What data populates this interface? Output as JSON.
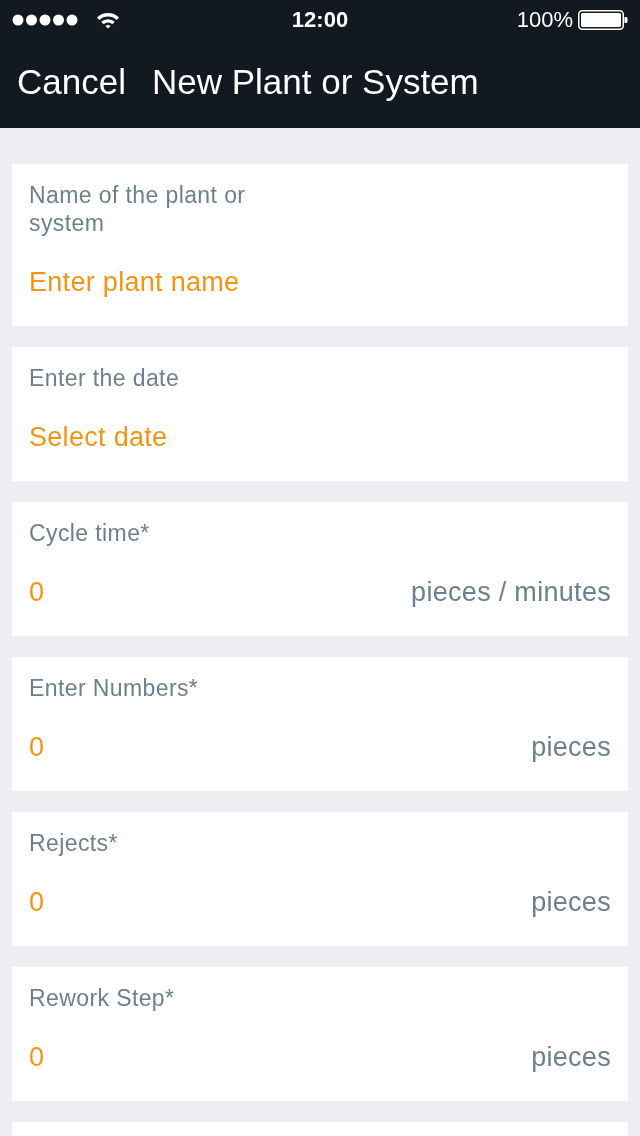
{
  "status_bar": {
    "time": "12:00",
    "battery": "100%"
  },
  "nav_bar": {
    "cancel": "Cancel",
    "title": "New Plant or System"
  },
  "fields": [
    {
      "kind": "text",
      "label": "Name of the plant or system",
      "placeholder": "Enter plant name"
    },
    {
      "kind": "date",
      "label": "Enter the date",
      "placeholder": "Select date"
    },
    {
      "kind": "number",
      "label": "Cycle time*",
      "value": "0",
      "unit": "pieces / minutes"
    },
    {
      "kind": "number",
      "label": "Enter Numbers*",
      "value": "0",
      "unit": "pieces"
    },
    {
      "kind": "number",
      "label": "Rejects*",
      "value": "0",
      "unit": "pieces"
    },
    {
      "kind": "number",
      "label": "Rework Step*",
      "value": "0",
      "unit": "pieces"
    },
    {
      "kind": "cut_off"
    }
  ]
}
